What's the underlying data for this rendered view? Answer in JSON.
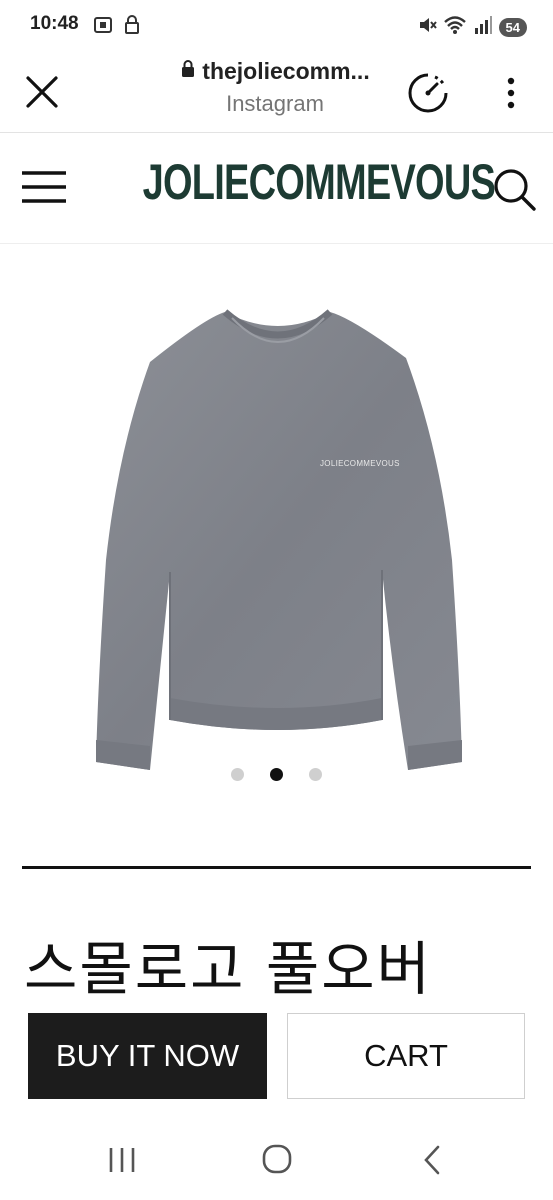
{
  "status_bar": {
    "time": "10:48",
    "battery": "54",
    "icons": [
      "screenshot-icon",
      "lock-icon",
      "mute-icon",
      "wifi-icon",
      "signal-icon"
    ]
  },
  "browser": {
    "url": "thejoliecomm...",
    "source": "Instagram",
    "icons": [
      "close-icon",
      "lock-icon",
      "speed-icon",
      "more-icon"
    ]
  },
  "site": {
    "brand": "JOLIECOMMEVOUS",
    "brand_color": "#1d3b33",
    "icons": [
      "menu-icon",
      "search-icon"
    ]
  },
  "product": {
    "image_alt": "sweater-image",
    "image_print": "JOLIECOMMEVOUS",
    "carousel": {
      "count": 3,
      "active_index": 1
    },
    "title": "스몰로고 풀오버",
    "buy_label": "BUY IT NOW",
    "cart_label": "CART"
  },
  "nav": {
    "icons": [
      "recent-apps-icon",
      "home-icon",
      "back-icon"
    ]
  }
}
